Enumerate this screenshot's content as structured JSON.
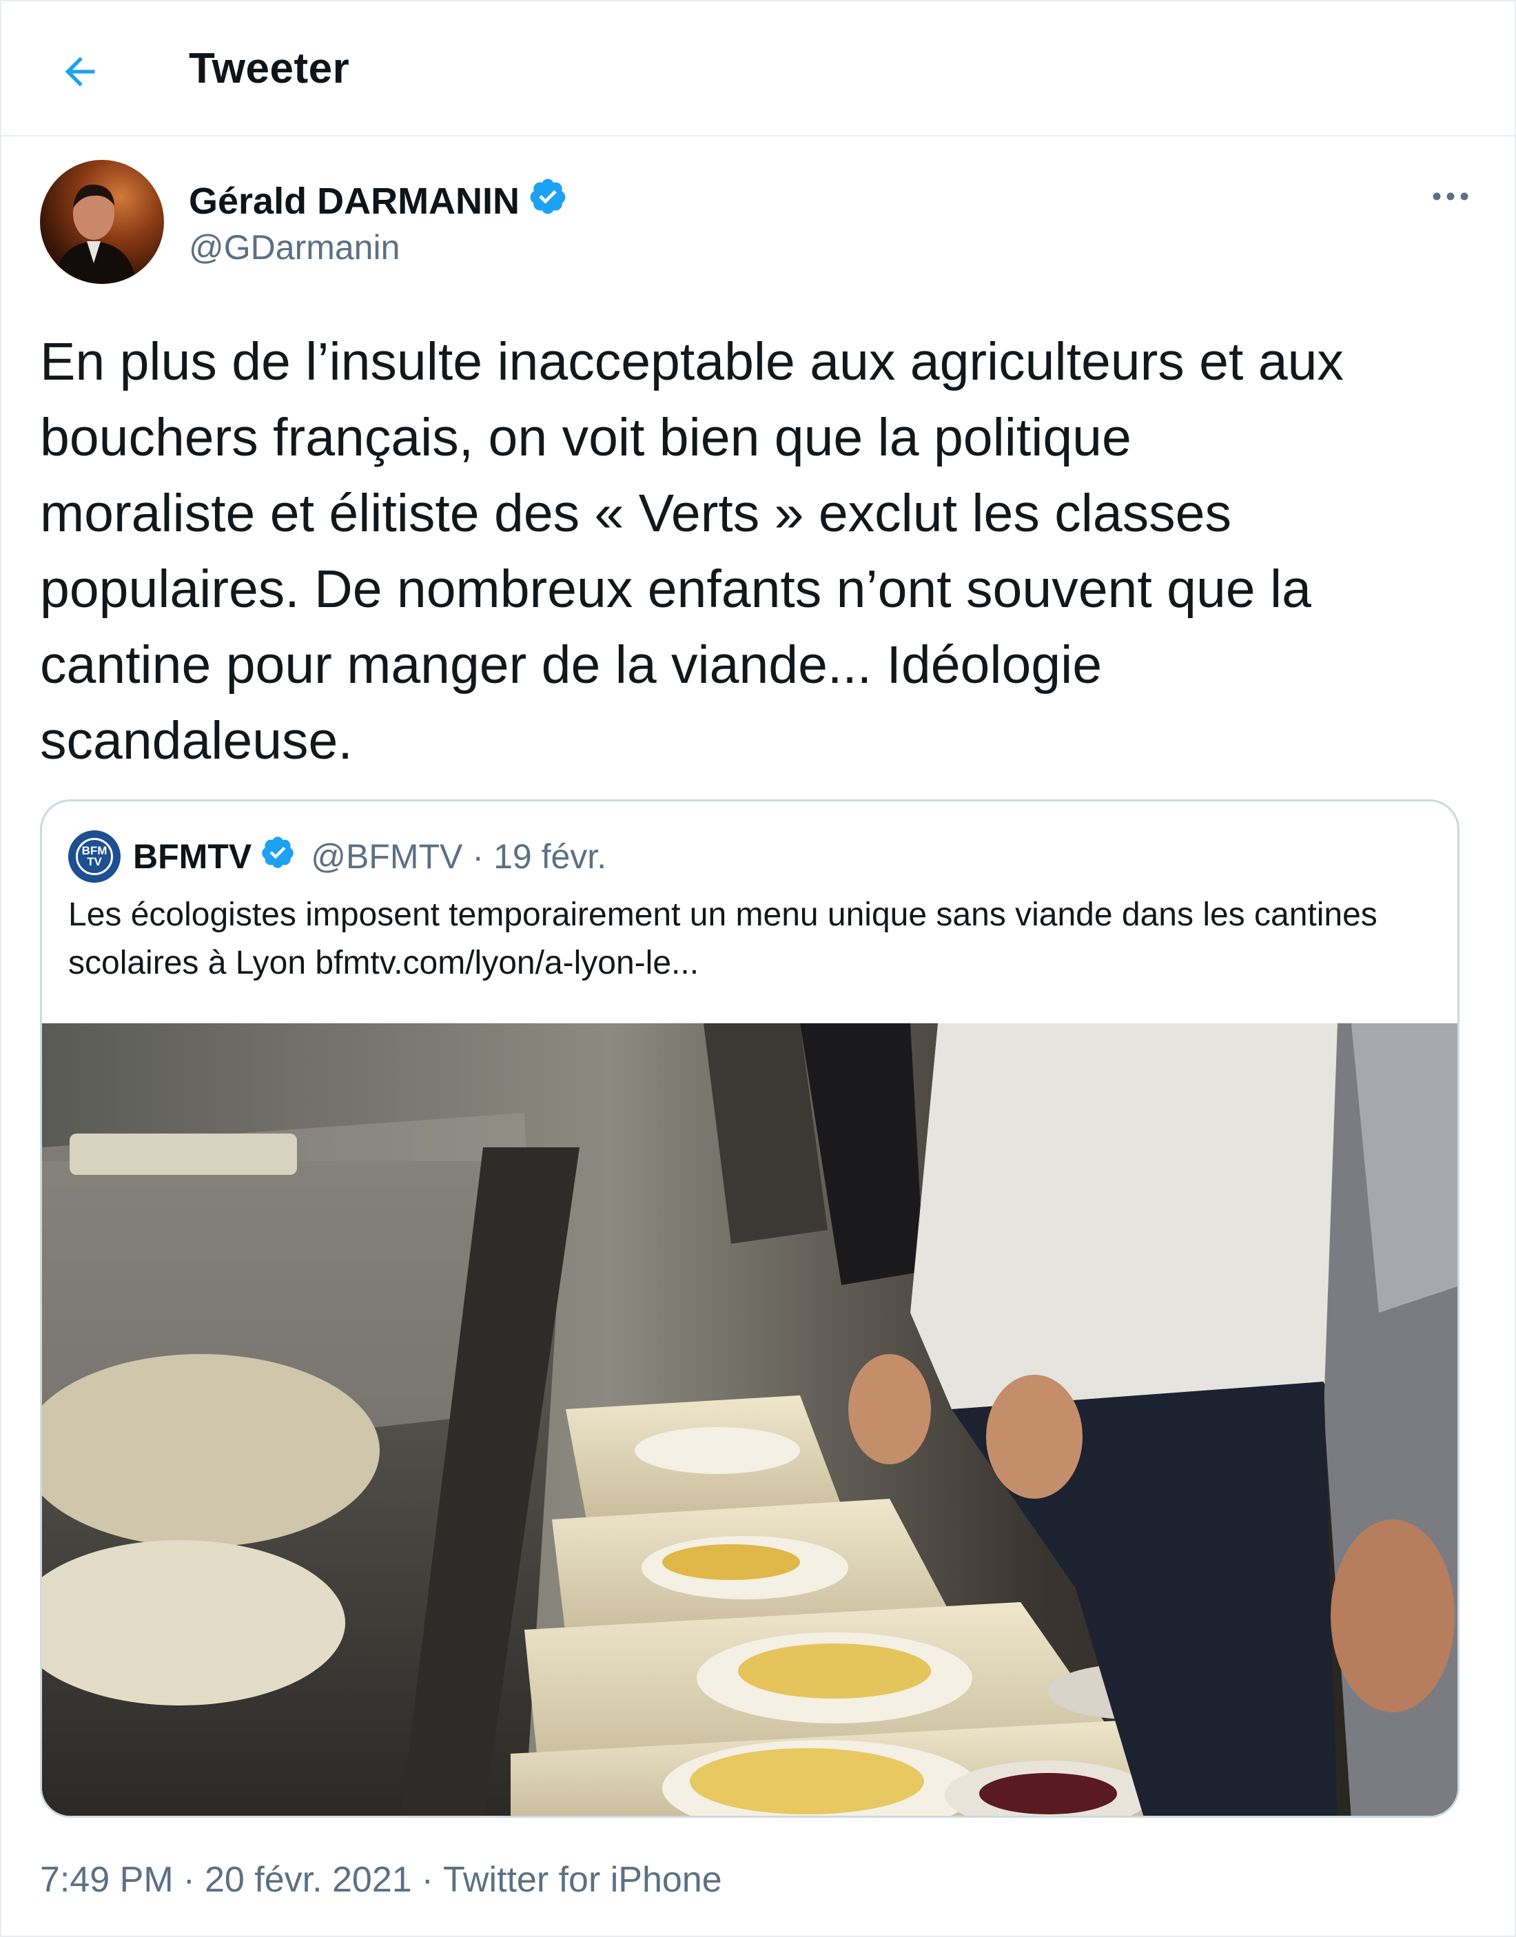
{
  "header": {
    "title": "Tweeter",
    "back_icon": "arrow-left-icon"
  },
  "author": {
    "name": "Gérald DARMANIN",
    "handle": "@GDarmanin",
    "verified": true
  },
  "tweet": {
    "text": "En plus de l’insulte inacceptable aux agriculteurs et aux\nbouchers français, on voit bien que la politique\nmoraliste et élitiste des « Verts » exclut les classes\npopulaires. De nombreux enfants n’ont souvent que la\ncantine pour manger de la viande... Idéologie\nscandaleuse."
  },
  "quote": {
    "name": "BFMTV",
    "handle": "@BFMTV",
    "date": "19 févr.",
    "separator": "·",
    "avatar_label": "BFM TV",
    "text": "Les écologistes imposent temporairement un menu unique sans viande dans les cantines scolaires à Lyon bfmtv.com/lyon/a-lyon-le..."
  },
  "footer": {
    "time": "7:49 PM",
    "date": "20 févr. 2021",
    "source": "Twitter for iPhone",
    "separator": "·"
  },
  "colors": {
    "accent": "#1da1f2",
    "text_primary": "#0f1419",
    "text_secondary": "#5b7083",
    "border": "#e6ecf0"
  }
}
